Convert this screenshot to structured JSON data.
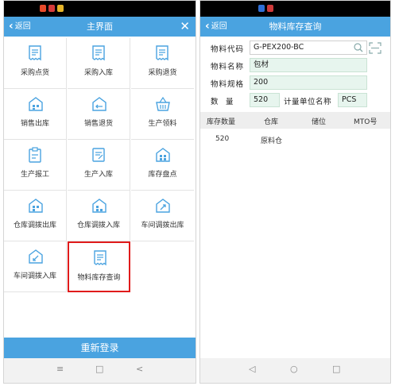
{
  "left": {
    "back_label": "返回",
    "title": "主界面",
    "close_label": "✕",
    "tiles": [
      {
        "label": "采购点货",
        "icon": "document-receipt-icon"
      },
      {
        "label": "采购入库",
        "icon": "document-receipt-icon"
      },
      {
        "label": "采购退货",
        "icon": "document-receipt-icon"
      },
      {
        "label": "销售出库",
        "icon": "warehouse-icon"
      },
      {
        "label": "销售退货",
        "icon": "warehouse-icon"
      },
      {
        "label": "生产领料",
        "icon": "basket-icon"
      },
      {
        "label": "生产报工",
        "icon": "clipboard-icon"
      },
      {
        "label": "生产入库",
        "icon": "form-edit-icon"
      },
      {
        "label": "库存盘点",
        "icon": "warehouse-grid-icon"
      },
      {
        "label": "仓库调拨出库",
        "icon": "warehouse-grid-icon"
      },
      {
        "label": "仓库调拨入库",
        "icon": "warehouse-grid-icon"
      },
      {
        "label": "车间调拨出库",
        "icon": "warehouse-out-icon"
      },
      {
        "label": "车间调拨入库",
        "icon": "warehouse-in-icon"
      },
      {
        "label": "物料库存查询",
        "icon": "document-receipt-icon"
      }
    ],
    "relogin_label": "重新登录",
    "nav": {
      "menu": "≡",
      "home": "□",
      "back": "<"
    }
  },
  "right": {
    "back_label": "返回",
    "title": "物料库存查询",
    "fields": {
      "code_label": "物料代码",
      "code_value": "G-PEX200-BC",
      "name_label": "物料名称",
      "name_value": "包材",
      "spec_label": "物料规格",
      "spec_value": "200",
      "qty_label": "数　量",
      "qty_value": "520",
      "unit_label": "计量单位名称",
      "unit_value": "PCS"
    },
    "table": {
      "headers": [
        "库存数量",
        "仓库",
        "储位",
        "MTO号"
      ],
      "rows": [
        [
          "520",
          "原料仓",
          "",
          ""
        ]
      ]
    },
    "nav": {
      "back": "◁",
      "home": "○",
      "recent": "□"
    }
  },
  "colors": {
    "accent": "#4aa3e0",
    "highlight": "#e01b1b",
    "field_bg": "#e7f5ee"
  }
}
